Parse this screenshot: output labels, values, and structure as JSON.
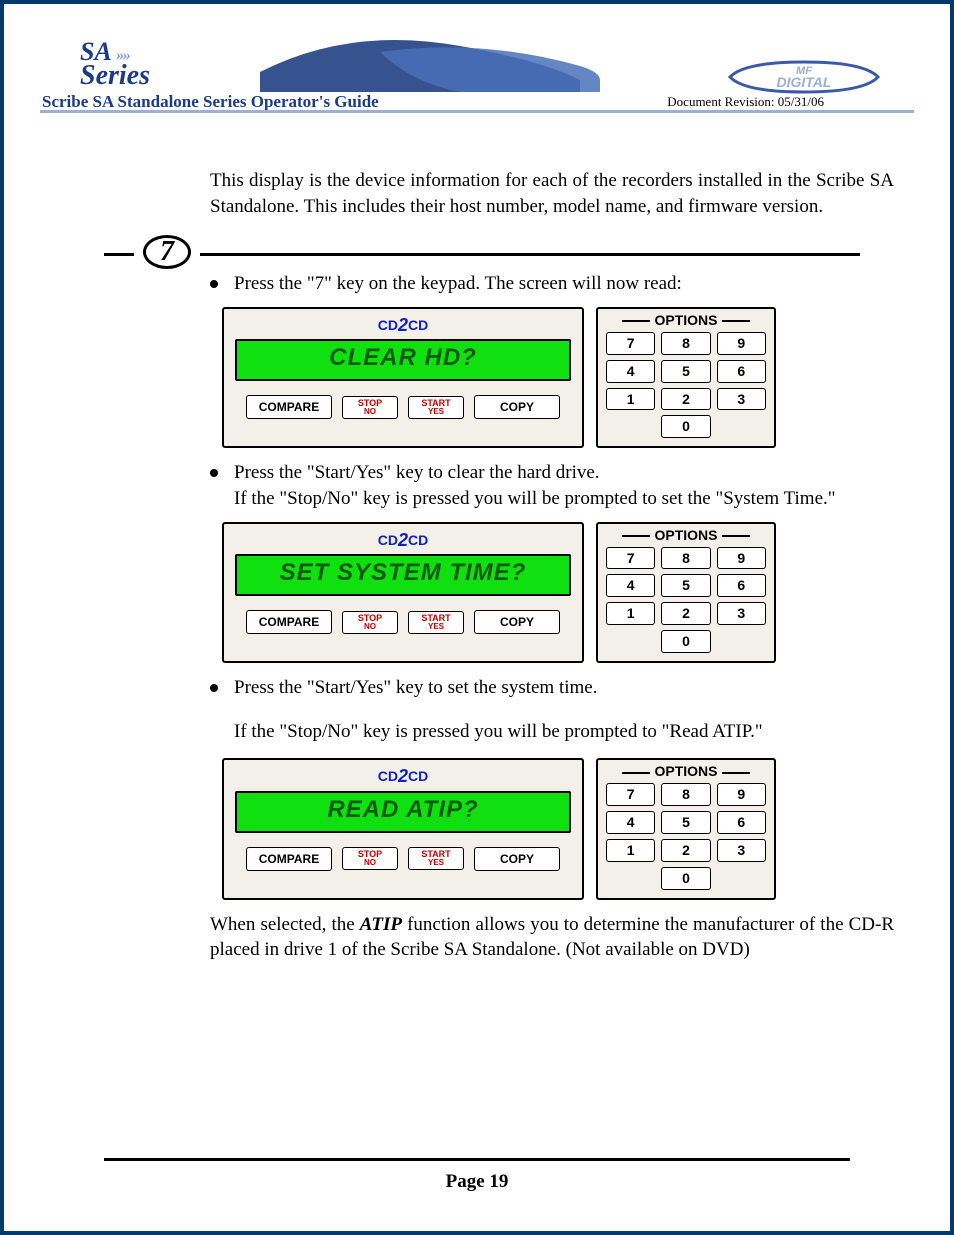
{
  "header": {
    "logo_top": "SA",
    "logo_bottom": "Series",
    "title": "Scribe SA Standalone Series Operator's Guide",
    "revision": "Document Revision: 05/31/06",
    "right_logo_top": "MF",
    "right_logo_bottom": "DIGITAL"
  },
  "intro_paragraph": "This display is the device information for each of the recorders installed in the Scribe SA Standalone. This includes their host number, model name, and firmware version.",
  "step_number": "7",
  "bullets": [
    {
      "text": "Press the \"7\" key on the keypad. The screen will now read:",
      "panel": {
        "lcd": "CLEAR HD?"
      },
      "after_lines": []
    },
    {
      "text": "Press the \"Start/Yes\" key to clear the hard drive.",
      "extra": "If the \"Stop/No\" key is pressed you will be prompted to set the \"System Time.\"",
      "panel": {
        "lcd": "SET SYSTEM TIME?"
      }
    },
    {
      "text": "Press the \"Start/Yes\" key to set the system time.",
      "gap_line": "If the \"Stop/No\" key is pressed you will be prompted to \"Read ATIP.\"",
      "panel": {
        "lcd": "READ ATIP?"
      }
    }
  ],
  "panel_common": {
    "title_left": "CD",
    "title_mid": "2",
    "title_right": "CD",
    "compare": "COMPARE",
    "stop": "STOP",
    "stop_sub": "NO",
    "start": "START",
    "start_sub": "YES",
    "copy": "COPY",
    "options": "OPTIONS",
    "keys": [
      "7",
      "8",
      "9",
      "4",
      "5",
      "6",
      "1",
      "2",
      "3"
    ],
    "zero": "0"
  },
  "atip_note_pre": "When selected, the ",
  "atip_note_bold": "ATIP",
  "atip_note_post": " function allows you to determine the manufacturer of the CD-R placed in drive 1 of the Scribe SA Standalone. (Not available on DVD)",
  "footer": "Page 19"
}
